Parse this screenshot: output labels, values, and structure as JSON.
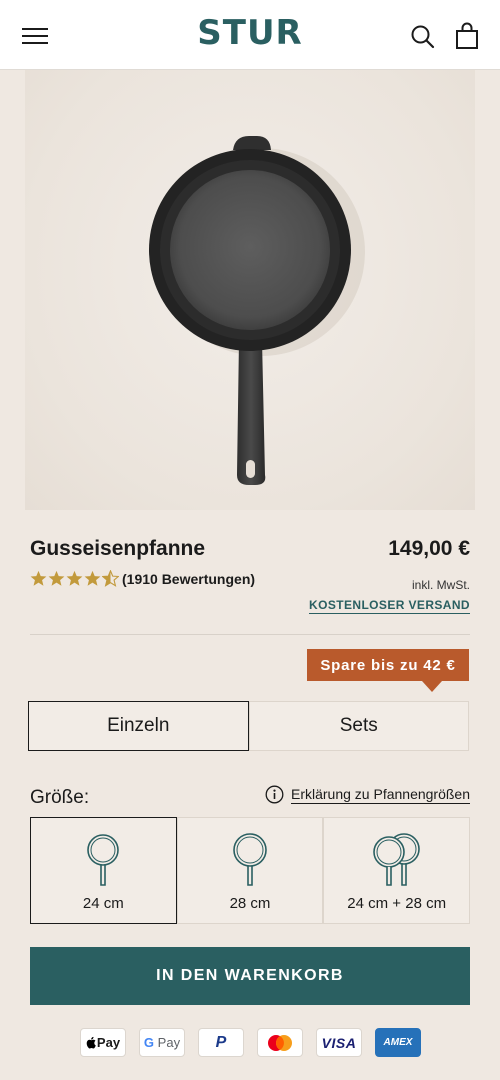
{
  "header": {
    "logo": "STUR",
    "icons": {
      "menu": "hamburger-menu-icon",
      "search": "search-icon",
      "cart": "shopping-bag-icon"
    }
  },
  "product": {
    "title": "Gusseisenpfanne",
    "price": "149,00 €",
    "rating": 4.5,
    "rating_max": 5,
    "review_count": "(1910 Bewertungen)",
    "vat": "inkl. MwSt.",
    "shipping": "KOSTENLOSER VERSAND"
  },
  "save_badge": "Spare bis zu 42 €",
  "tabs": [
    {
      "label": "Einzeln",
      "active": true
    },
    {
      "label": "Sets",
      "active": false
    }
  ],
  "size": {
    "label": "Größe:",
    "help_link": "Erklärung zu Pfannengrößen",
    "options": [
      {
        "label": "24 cm",
        "active": true
      },
      {
        "label": "28 cm",
        "active": false
      },
      {
        "label": "24 cm + 28 cm",
        "active": false
      }
    ]
  },
  "cta": {
    "label": "IN DEN WARENKORB"
  },
  "payments": {
    "apple_pay": "Pay",
    "google_pay": "Pay",
    "paypal": "P",
    "mastercard": "mastercard",
    "visa": "VISA",
    "amex": "AMEX"
  },
  "colors": {
    "brand": "#2a5f61",
    "accent": "#b95a2c",
    "star": "#c29a3c",
    "background": "#efe8e1"
  }
}
